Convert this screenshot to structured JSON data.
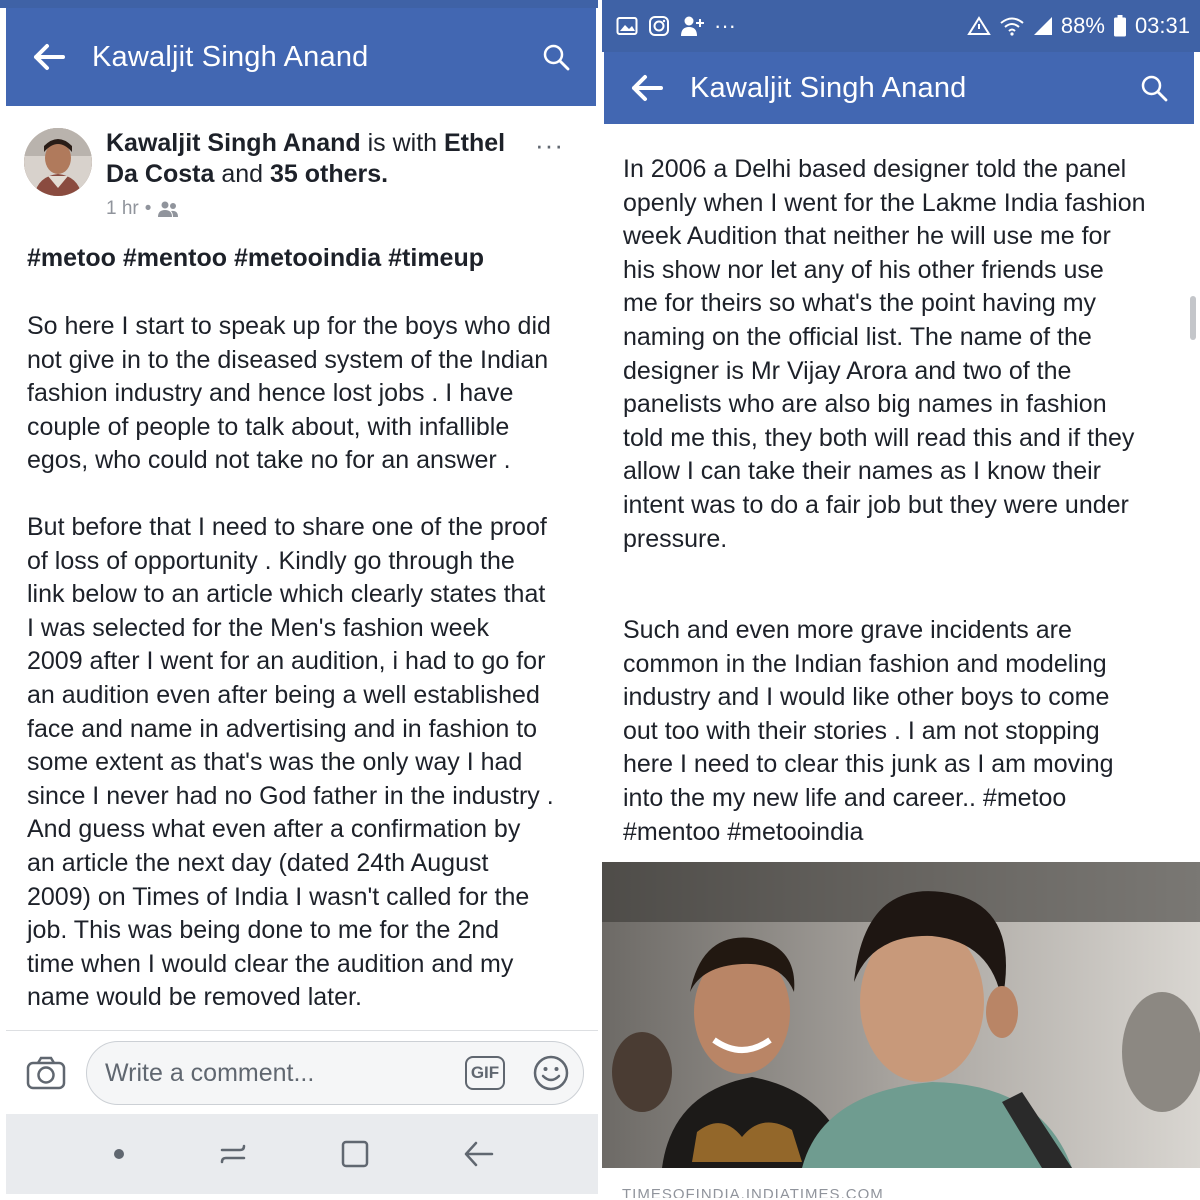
{
  "left": {
    "appbar": {
      "title": "Kawaljit Singh Anand"
    },
    "post": {
      "author": "Kawaljit Singh Anand",
      "with_word": " is with ",
      "tagged": "Ethel Da Costa",
      "and_word": " and ",
      "others": "35 others.",
      "time": "1 hr",
      "more": "···",
      "hashtags": "#metoo #mentoo #metooindia #timeup",
      "para1": "So here I start to speak up for the boys who did\nnot give in to the diseased system of the Indian\nfashion industry and hence lost jobs . I have\ncouple of people to talk about, with infallible\negos, who could not take no for an answer .",
      "para2": "But before that I need to share one of the proof\nof loss of opportunity . Kindly go through the\nlink below to an article which clearly states that\nI was selected for the Men's fashion week\n2009 after I went for an audition, i had to go for\nan audition even after being a well established\nface  and name in advertising and in fashion to\nsome extent as  that's was the only way I had\nsince I never had no God father in the industry .\nAnd guess what even after a confirmation by\nan article the next day (dated 24th August\n2009) on Times of India I wasn't called for the\njob. This was being done to me  for the 2nd\ntime when I would clear the audition and my\nname would be removed later."
    },
    "comment": {
      "placeholder": "Write a comment...",
      "gif": "GIF"
    }
  },
  "right": {
    "status": {
      "battery": "88%",
      "time": "03:31"
    },
    "appbar": {
      "title": "Kawaljit Singh Anand"
    },
    "para1": "In 2006 a Delhi based designer told the panel\nopenly when I went for the Lakme India fashion\nweek Audition  that neither he will use me for\nhis show nor let any of his other friends use\nme for theirs so what's the point having my\nnaming on the official list. The name of the\ndesigner is Mr Vijay Arora and two of the\npanelists who are also big names in fashion\ntold me this, they both will read this and if they\nallow I can take their names as I know their\nintent was to do a fair job but they were under\npressure.",
    "para2": "Such and even more grave incidents are\ncommon in the Indian fashion and modeling\nindustry and I would like other boys to come\nout too with their stories . I am not stopping\nhere I need to clear this junk as I am moving\ninto the my new life and career.. #metoo\n#mentoo #metooindia",
    "link_caption": "TIMESOFINDIA.INDIATIMES.COM"
  },
  "colors": {
    "facebook_blue": "#4267b2",
    "status_blue": "#3f62a6",
    "text": "#1d2129",
    "meta_gray": "#90949c"
  },
  "icons": [
    "back-arrow-icon",
    "search-icon",
    "audience-icon",
    "camera-icon",
    "gif-icon",
    "smiley-icon",
    "recents-icon",
    "home-icon",
    "nav-back-icon",
    "gallery-icon",
    "instagram-icon",
    "add-user-icon",
    "wifi-icon",
    "signal-icon",
    "battery-icon"
  ]
}
